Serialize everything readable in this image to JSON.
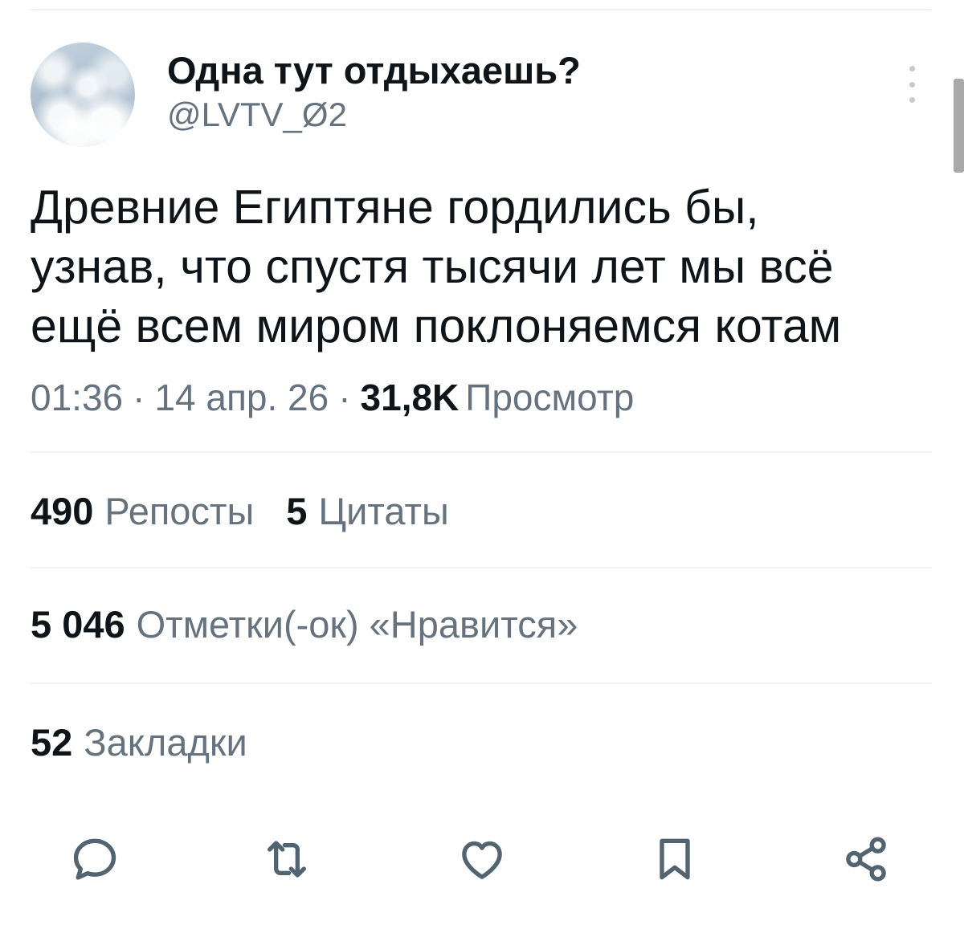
{
  "header": {
    "display_name": "Одна тут отдыхаешь?",
    "handle": "@LVTV_Ø2",
    "avatar_icon": "cloud-avatar",
    "more_icon": "more-vertical-icon"
  },
  "tweet": {
    "text_lines": [
      "Древние Египтяне гордились бы,",
      "узнав, что спустя тысячи лет мы всё",
      "ещё всем миром поклоняемся котам"
    ],
    "time": "01:36",
    "separator": "·",
    "date": "14 апр. 26",
    "views_count": "31,8K",
    "views_label": "Просмотр"
  },
  "stats": {
    "reposts_count": "490",
    "reposts_label": "Репосты",
    "quotes_count": "5",
    "quotes_label": "Цитаты",
    "likes_count": "5 046",
    "likes_label": "Отметки(-ок) «Нравится»",
    "bookmarks_count": "52",
    "bookmarks_label": "Закладки"
  },
  "actions": [
    {
      "icon": "reply-icon"
    },
    {
      "icon": "repost-icon"
    },
    {
      "icon": "like-icon"
    },
    {
      "icon": "bookmark-icon"
    },
    {
      "icon": "share-icon"
    }
  ],
  "colors": {
    "text": "#0f1419",
    "secondary": "#66737f",
    "icon": "#536471",
    "divider": "#eff3f4",
    "scrollbar": "#a9a9a9"
  }
}
